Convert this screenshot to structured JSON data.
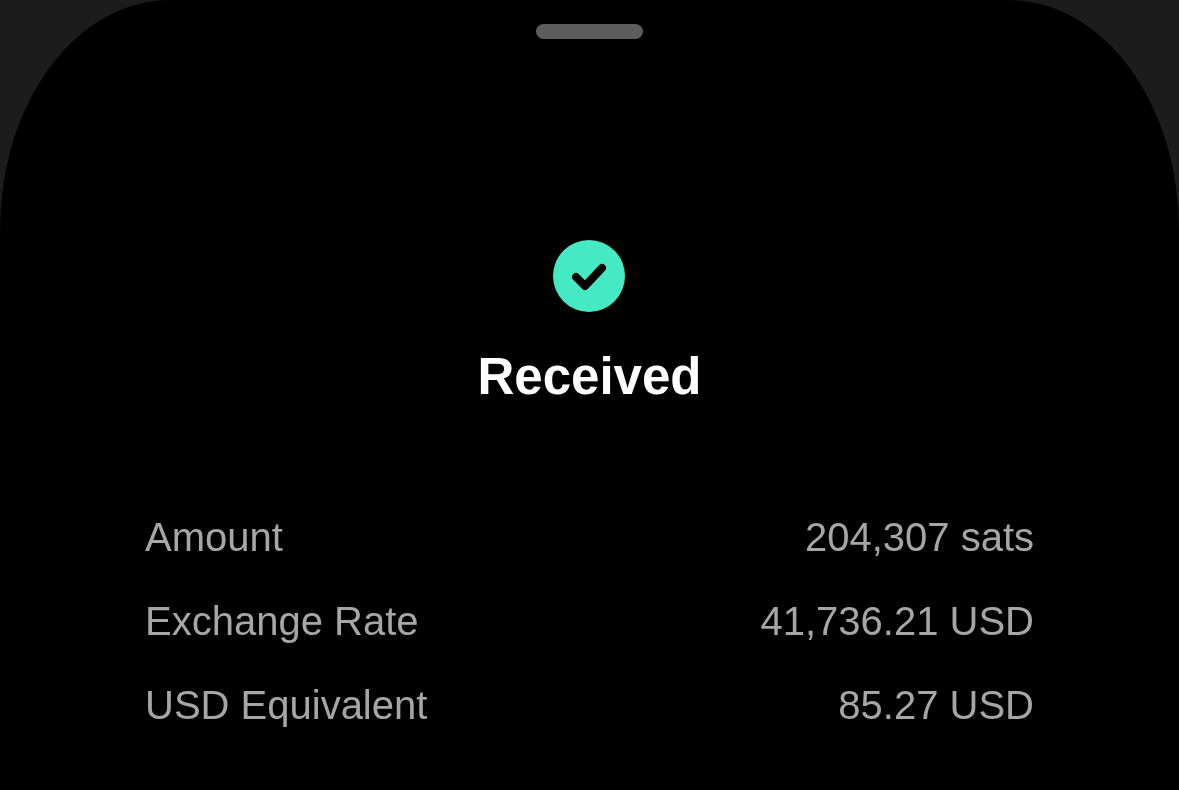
{
  "sheet": {
    "status": {
      "kind": "success",
      "title": "Received"
    },
    "details": [
      {
        "label": "Amount",
        "value": "204,307 sats"
      },
      {
        "label": "Exchange Rate",
        "value": "41,736.21 USD"
      },
      {
        "label": "USD Equivalent",
        "value": "85.27 USD"
      }
    ]
  }
}
